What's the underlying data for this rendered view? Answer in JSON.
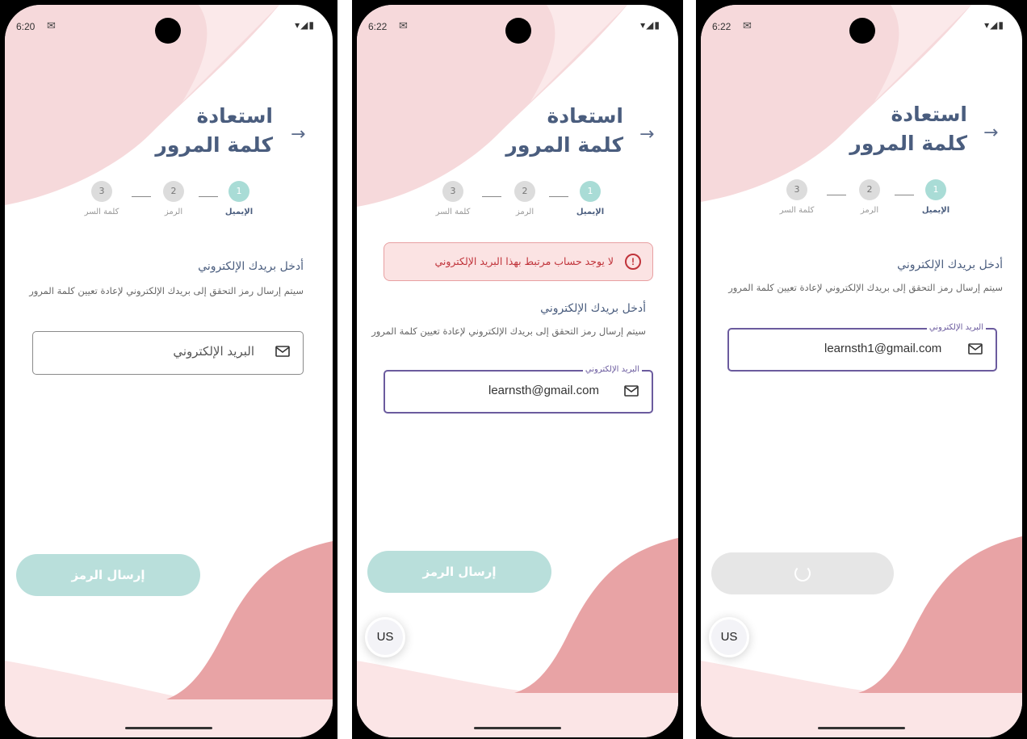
{
  "screens": [
    {
      "status": {
        "time": "6:20",
        "mail_icon": "gmail-icon",
        "icons": "▾◢▮"
      },
      "title": {
        "line1": "استعادة",
        "line2": "كلمة المرور"
      },
      "back_icon": "arrow-right-icon",
      "steps": [
        {
          "number": "1",
          "label": "الإيميل",
          "state": "active"
        },
        {
          "number": "2",
          "label": "الرمز",
          "state": "inactive"
        },
        {
          "number": "3",
          "label": "كلمة السر",
          "state": "inactive"
        }
      ],
      "heading": "أدخل بريدك الإلكتروني",
      "description": "سيتم إرسال رمز التحقق إلى بريدك الإلكتروني لإعادة تعيين كلمة المرور",
      "email_field": {
        "placeholder": "البريد الإلكتروني",
        "value": "",
        "state": "empty"
      },
      "send_button": {
        "label": "إرسال الرمز",
        "state": "disabled"
      }
    },
    {
      "status": {
        "time": "6:22",
        "mail_icon": "gmail-icon",
        "icons": "▾◢▮"
      },
      "title": {
        "line1": "استعادة",
        "line2": "كلمة المرور"
      },
      "back_icon": "arrow-right-icon",
      "steps": [
        {
          "number": "1",
          "label": "الإيميل",
          "state": "active"
        },
        {
          "number": "2",
          "label": "الرمز",
          "state": "inactive"
        },
        {
          "number": "3",
          "label": "كلمة السر",
          "state": "inactive"
        }
      ],
      "error": {
        "text": "لا يوجد حساب مرتبط بهذا البريد الإلكتروني",
        "icon": "error-circle-icon"
      },
      "heading": "أدخل بريدك الإلكتروني",
      "description": "سيتم إرسال رمز التحقق إلى بريدك الإلكتروني لإعادة تعيين كلمة المرور",
      "email_field": {
        "label": "البريد الإلكتروني",
        "value": "learnsth@gmail.com",
        "state": "focused"
      },
      "send_button": {
        "label": "إرسال الرمز",
        "state": "disabled"
      },
      "language_button": {
        "label": "US"
      }
    },
    {
      "status": {
        "time": "6:22",
        "mail_icon": "gmail-icon",
        "icons": "▾◢▮"
      },
      "title": {
        "line1": "استعادة",
        "line2": "كلمة المرور"
      },
      "back_icon": "arrow-right-icon",
      "steps": [
        {
          "number": "1",
          "label": "الإيميل",
          "state": "active"
        },
        {
          "number": "2",
          "label": "الرمز",
          "state": "inactive"
        },
        {
          "number": "3",
          "label": "كلمة السر",
          "state": "inactive"
        }
      ],
      "heading": "أدخل بريدك الإلكتروني",
      "description": "سيتم إرسال رمز التحقق إلى بريدك الإلكتروني لإعادة تعيين كلمة المرور",
      "email_field": {
        "label": "البريد الإلكتروني",
        "value": "learnsth1@gmail.com",
        "state": "focused"
      },
      "send_button": {
        "label": "",
        "state": "loading"
      },
      "language_button": {
        "label": "US"
      }
    }
  ],
  "colors": {
    "title": "#4a5d7e",
    "step_active": "#a9dcd6",
    "step_inactive": "#dcdcdc",
    "button_teal": "#b9dfdb",
    "button_loading": "#e6e6e6",
    "error": "#c0333a",
    "error_bg": "#fbe3e3",
    "focus_border": "#6b5b9e",
    "blob_pink": "#f6d9db",
    "blob_rose": "#e8a3a5"
  }
}
